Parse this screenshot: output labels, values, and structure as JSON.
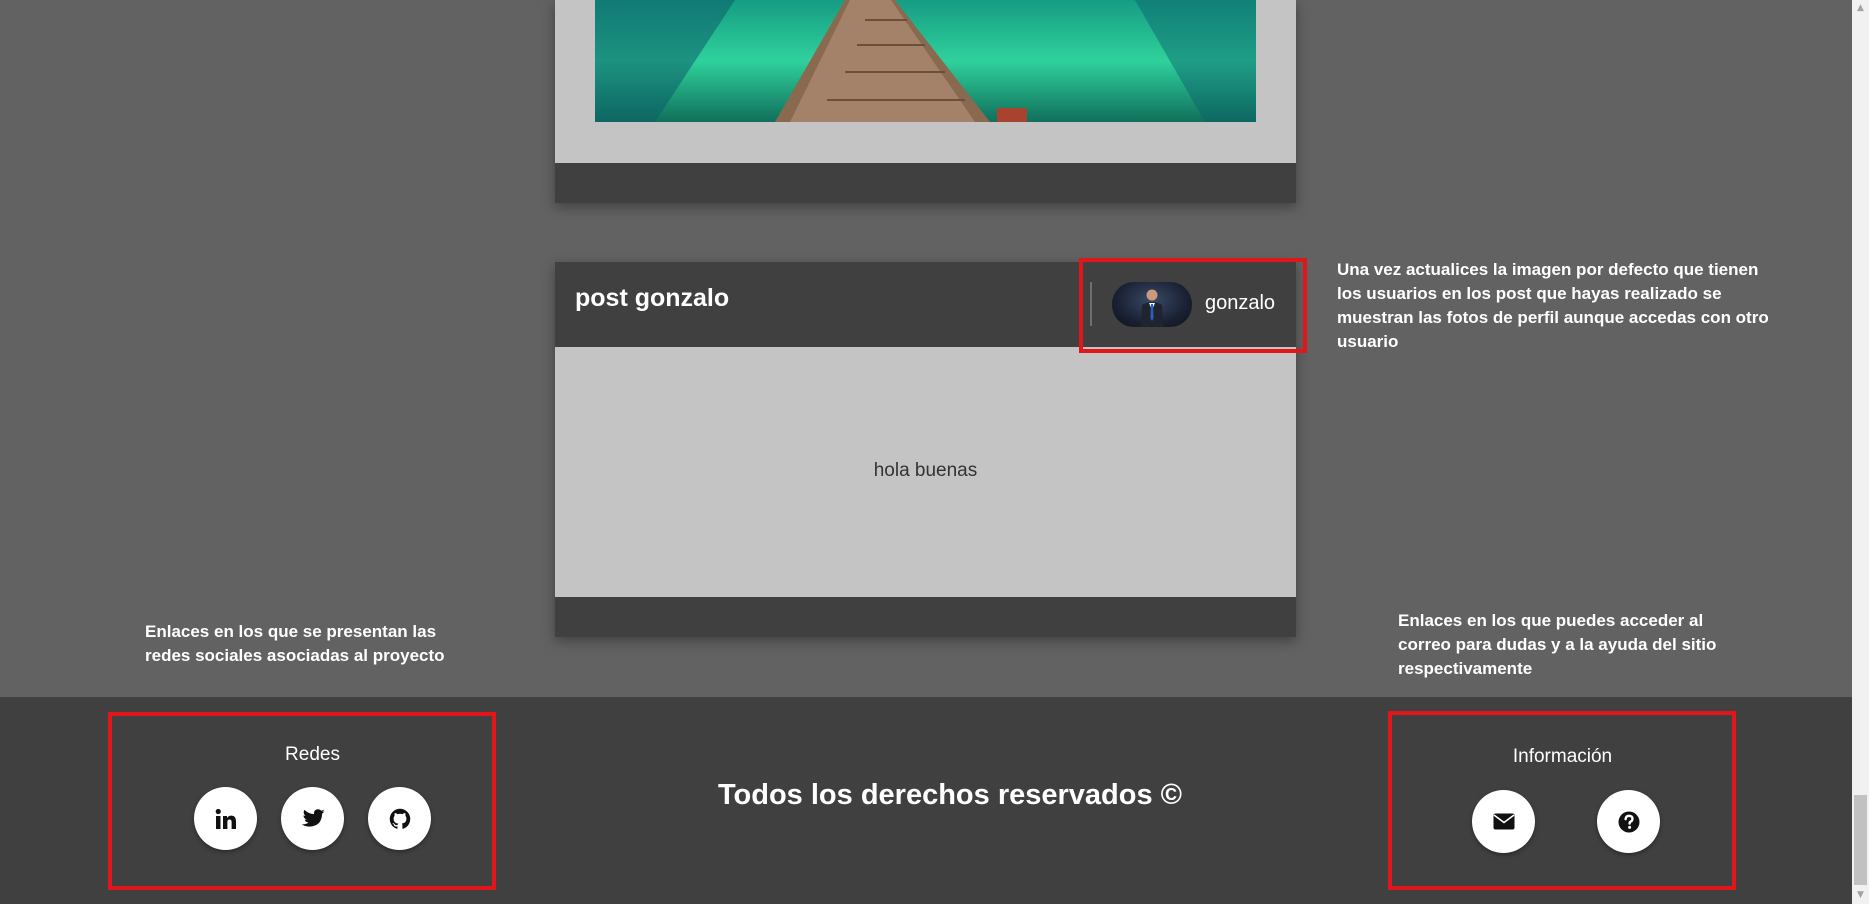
{
  "post_top": {},
  "post": {
    "title": "post gonzalo",
    "author": "gonzalo",
    "content": "hola buenas"
  },
  "annotations": {
    "profile_note": "Una vez actualices la imagen por defecto que tienen los usuarios en los post que hayas realizado se muestran las fotos de perfil aunque accedas con otro usuario",
    "social_note": "Enlaces en los que se presentan las redes sociales asociadas al proyecto",
    "info_note": "Enlaces en los que puedes acceder al correo para dudas y a la ayuda del sitio respectivamente"
  },
  "footer": {
    "social_heading": "Redes",
    "social_links": [
      {
        "icon": "linkedin-icon"
      },
      {
        "icon": "twitter-icon"
      },
      {
        "icon": "github-icon"
      }
    ],
    "copyright": "Todos los derechos reservados ©",
    "info_heading": "Información",
    "info_links": [
      {
        "icon": "envelope-icon"
      },
      {
        "icon": "question-circle-icon"
      }
    ]
  },
  "colors": {
    "page_background": "#626262",
    "card_background": "#c4c4c4",
    "dark_bar": "#404040",
    "annotation_red": "#e0161b"
  }
}
